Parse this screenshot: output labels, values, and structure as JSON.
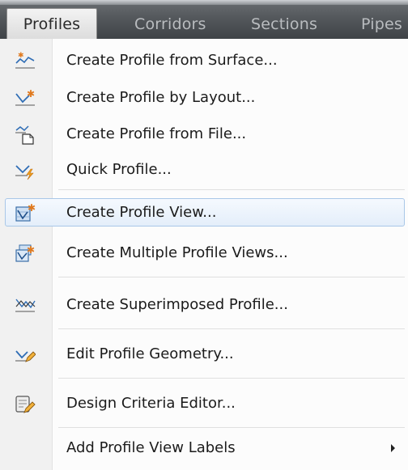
{
  "menubar": {
    "items": [
      {
        "label": "Profiles",
        "active": true
      },
      {
        "label": "Corridors"
      },
      {
        "label": "Sections"
      },
      {
        "label": "Pipes"
      }
    ]
  },
  "menu": {
    "items": [
      {
        "label": "Create Profile from Surface...",
        "icon": "profile-from-surface-icon"
      },
      {
        "label": "Create Profile by Layout...",
        "icon": "profile-by-layout-icon"
      },
      {
        "label": "Create Profile from File...",
        "icon": "profile-from-file-icon"
      },
      {
        "label": "Quick Profile...",
        "icon": "quick-profile-icon"
      },
      {
        "label": "Create Profile View...",
        "icon": "profile-view-icon",
        "highlighted": true
      },
      {
        "label": "Create Multiple Profile Views...",
        "icon": "multiple-profile-views-icon"
      },
      {
        "label": "Create Superimposed Profile...",
        "icon": "superimposed-profile-icon"
      },
      {
        "label": "Edit Profile Geometry...",
        "icon": "edit-profile-geometry-icon"
      },
      {
        "label": "Design Criteria Editor...",
        "icon": "design-criteria-editor-icon"
      },
      {
        "label": "Add Profile View Labels",
        "submenu": true
      }
    ]
  },
  "colors": {
    "menubar_bg": "#54585c",
    "highlight_border": "#a9c7e8",
    "icon_orange": "#e07a1f",
    "icon_blue": "#2f6db5"
  }
}
